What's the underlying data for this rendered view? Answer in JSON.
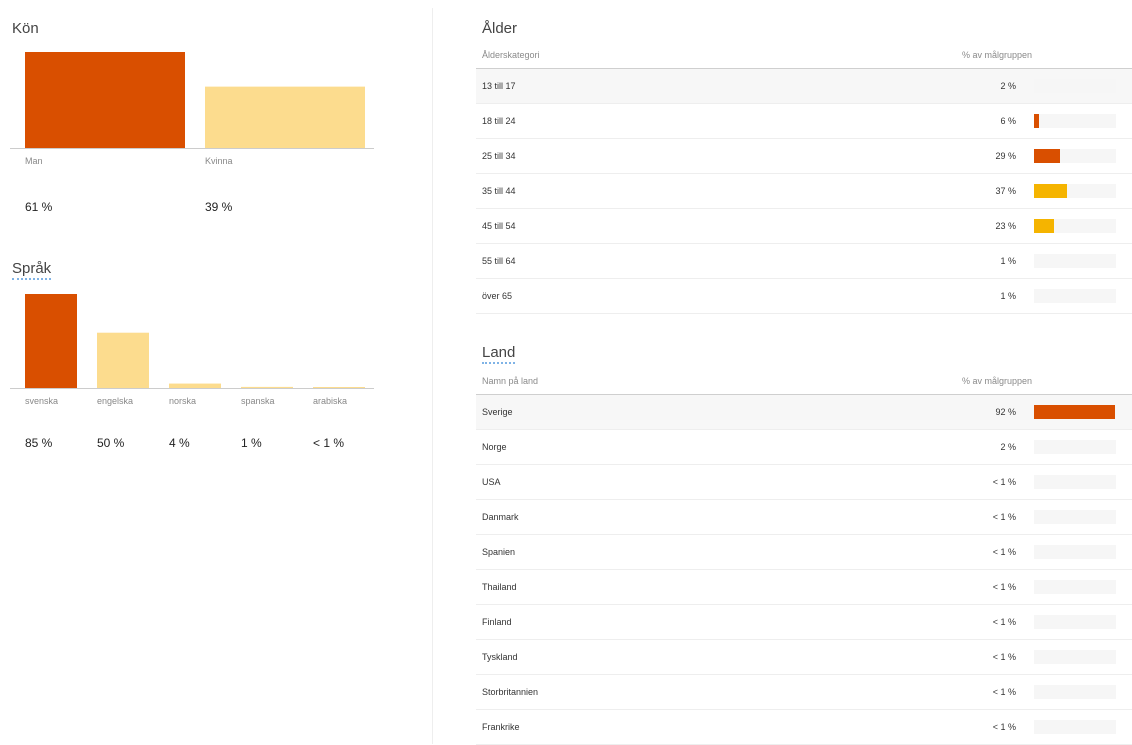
{
  "colors": {
    "primary": "#d94f00",
    "light": "#fcdc8e",
    "mid": "#f5b400",
    "track": "#f6f6f6"
  },
  "kon": {
    "title": "Kön",
    "categories": [
      "Man",
      "Kvinna"
    ],
    "values": [
      61,
      39
    ],
    "labels": [
      "61 %",
      "39 %"
    ]
  },
  "sprak": {
    "title": "Språk",
    "categories": [
      "svenska",
      "engelska",
      "norska",
      "spanska",
      "arabiska"
    ],
    "values": [
      85,
      50,
      4,
      1,
      0.5
    ],
    "labels": [
      "85 %",
      "50 %",
      "4 %",
      "1 %",
      "< 1 %"
    ]
  },
  "alder": {
    "title": "Ålder",
    "col_left": "Ålderskategori",
    "col_right": "% av målgruppen",
    "rows": [
      {
        "name": "13 till 17",
        "pct": "2 %",
        "value": 2,
        "color": "none"
      },
      {
        "name": "18 till 24",
        "pct": "6 %",
        "value": 6,
        "color": "primary"
      },
      {
        "name": "25 till 34",
        "pct": "29 %",
        "value": 29,
        "color": "primary"
      },
      {
        "name": "35 till 44",
        "pct": "37 %",
        "value": 37,
        "color": "mid"
      },
      {
        "name": "45 till 54",
        "pct": "23 %",
        "value": 23,
        "color": "mid"
      },
      {
        "name": "55 till 64",
        "pct": "1 %",
        "value": 1,
        "color": "none"
      },
      {
        "name": "över 65",
        "pct": "1 %",
        "value": 1,
        "color": "none"
      }
    ]
  },
  "land": {
    "title": "Land",
    "col_left": "Namn på land",
    "col_right": "% av målgruppen",
    "rows": [
      {
        "name": "Sverige",
        "pct": "92 %",
        "value": 92,
        "color": "primary"
      },
      {
        "name": "Norge",
        "pct": "2 %",
        "value": 2,
        "color": "none"
      },
      {
        "name": "USA",
        "pct": "< 1 %",
        "value": 0.5,
        "color": "none"
      },
      {
        "name": "Danmark",
        "pct": "< 1 %",
        "value": 0.5,
        "color": "none"
      },
      {
        "name": "Spanien",
        "pct": "< 1 %",
        "value": 0.5,
        "color": "none"
      },
      {
        "name": "Thailand",
        "pct": "< 1 %",
        "value": 0.5,
        "color": "none"
      },
      {
        "name": "Finland",
        "pct": "< 1 %",
        "value": 0.5,
        "color": "none"
      },
      {
        "name": "Tyskland",
        "pct": "< 1 %",
        "value": 0.5,
        "color": "none"
      },
      {
        "name": "Storbritannien",
        "pct": "< 1 %",
        "value": 0.5,
        "color": "none"
      },
      {
        "name": "Frankrike",
        "pct": "< 1 %",
        "value": 0.5,
        "color": "none"
      }
    ]
  },
  "chart_data": [
    {
      "type": "bar",
      "title": "Kön",
      "categories": [
        "Man",
        "Kvinna"
      ],
      "values": [
        61,
        39
      ],
      "xlabel": "",
      "ylabel": "",
      "ylim": [
        0,
        61
      ]
    },
    {
      "type": "bar",
      "title": "Språk",
      "categories": [
        "svenska",
        "engelska",
        "norska",
        "spanska",
        "arabiska"
      ],
      "values": [
        85,
        50,
        4,
        1,
        0.5
      ],
      "xlabel": "",
      "ylabel": "",
      "ylim": [
        0,
        85
      ]
    },
    {
      "type": "table",
      "title": "Ålder",
      "columns": [
        "Ålderskategori",
        "% av målgruppen"
      ],
      "categories": [
        "13 till 17",
        "18 till 24",
        "25 till 34",
        "35 till 44",
        "45 till 54",
        "55 till 64",
        "över 65"
      ],
      "values": [
        2,
        6,
        29,
        37,
        23,
        1,
        1
      ]
    },
    {
      "type": "table",
      "title": "Land",
      "columns": [
        "Namn på land",
        "% av målgruppen"
      ],
      "categories": [
        "Sverige",
        "Norge",
        "USA",
        "Danmark",
        "Spanien",
        "Thailand",
        "Finland",
        "Tyskland",
        "Storbritannien",
        "Frankrike"
      ],
      "values": [
        92,
        2,
        0.5,
        0.5,
        0.5,
        0.5,
        0.5,
        0.5,
        0.5,
        0.5
      ]
    }
  ]
}
